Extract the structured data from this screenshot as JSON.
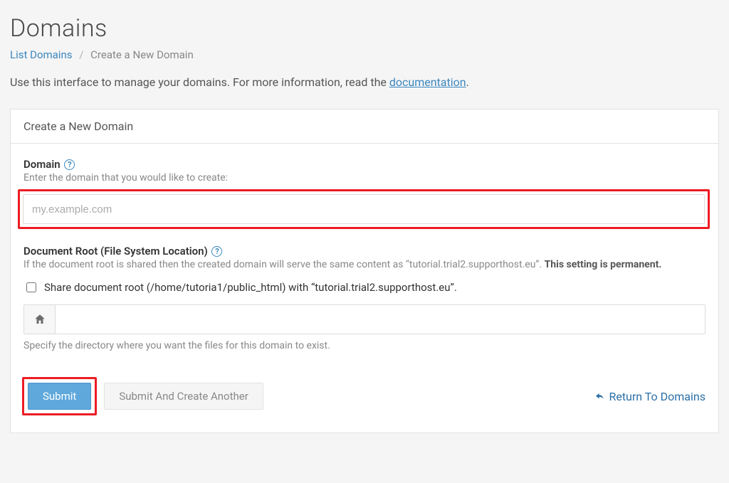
{
  "page": {
    "title": "Domains",
    "intro_prefix": "Use this interface to manage your domains. For more information, read the ",
    "intro_link": "documentation",
    "intro_suffix": "."
  },
  "breadcrumb": {
    "root": "List Domains",
    "current": "Create a New Domain"
  },
  "panel": {
    "header": "Create a New Domain"
  },
  "domain": {
    "label": "Domain",
    "hint": "Enter the domain that you would like to create:",
    "placeholder": "my.example.com",
    "value": ""
  },
  "docroot": {
    "label": "Document Root (File System Location)",
    "hint_prefix": "If the document root is shared then the created domain will serve the same content as “tutorial.trial2.supporthost.eu”. ",
    "hint_bold": "This setting is permanent.",
    "checkbox_label": "Share document root (/home/tutoria1/public_html) with “tutorial.trial2.supporthost.eu”.",
    "path_value": "",
    "spec_hint": "Specify the directory where you want the files for this domain to exist."
  },
  "actions": {
    "submit": "Submit",
    "submit_another": "Submit And Create Another",
    "return": "Return To Domains"
  },
  "help_glyph": "?"
}
